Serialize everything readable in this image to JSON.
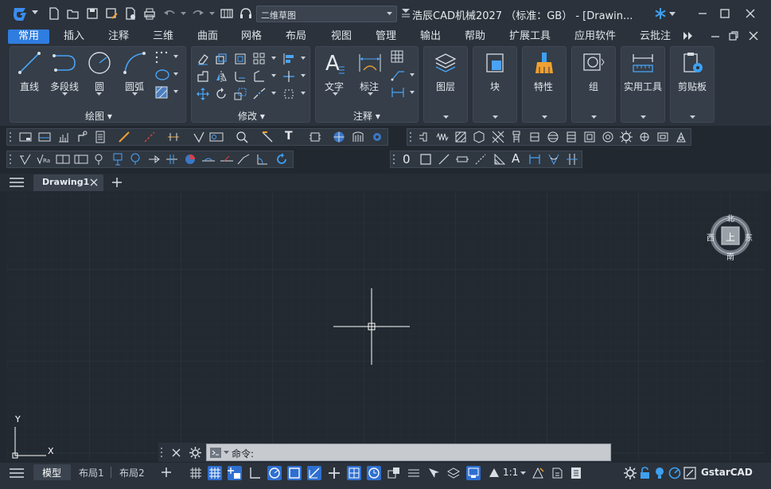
{
  "app": {
    "title": "浩辰CAD机械2027  （标准：GB）  - [Drawin...",
    "workspace": "二维草图",
    "brand": "GstarCAD",
    "accent": "#2f7de0"
  },
  "menu": [
    "常用",
    "插入",
    "注释",
    "三维",
    "曲面",
    "网格",
    "布局",
    "视图",
    "管理",
    "输出",
    "帮助",
    "扩展工具",
    "应用软件",
    "云批注"
  ],
  "ribbon": {
    "draw": {
      "line": "直线",
      "polyline": "多段线",
      "circle": "圆",
      "arc": "圆弧",
      "panel": "绘图 ▾"
    },
    "modify": {
      "panel": "修改 ▾"
    },
    "annotation": {
      "text": "文字",
      "dim": "标注",
      "panel": "注释 ▾"
    },
    "layer": "图层",
    "block": "块",
    "properties": "特性",
    "group": "组",
    "utilities": "实用工具",
    "clipboard": "剪贴板"
  },
  "toolbar2": {
    "zero": "0",
    "text_a": "A",
    "t_label": "T"
  },
  "tabs": {
    "drawing": "Drawing1"
  },
  "viewcube": {
    "north": "北",
    "south": "南",
    "east": "东",
    "west": "西",
    "top": "上"
  },
  "ucs": {
    "x": "X",
    "y": "Y"
  },
  "command": {
    "prompt": "命令:"
  },
  "status": {
    "model": "模型",
    "layout1": "布局1",
    "layout2": "布局2",
    "scale": "1:1"
  }
}
